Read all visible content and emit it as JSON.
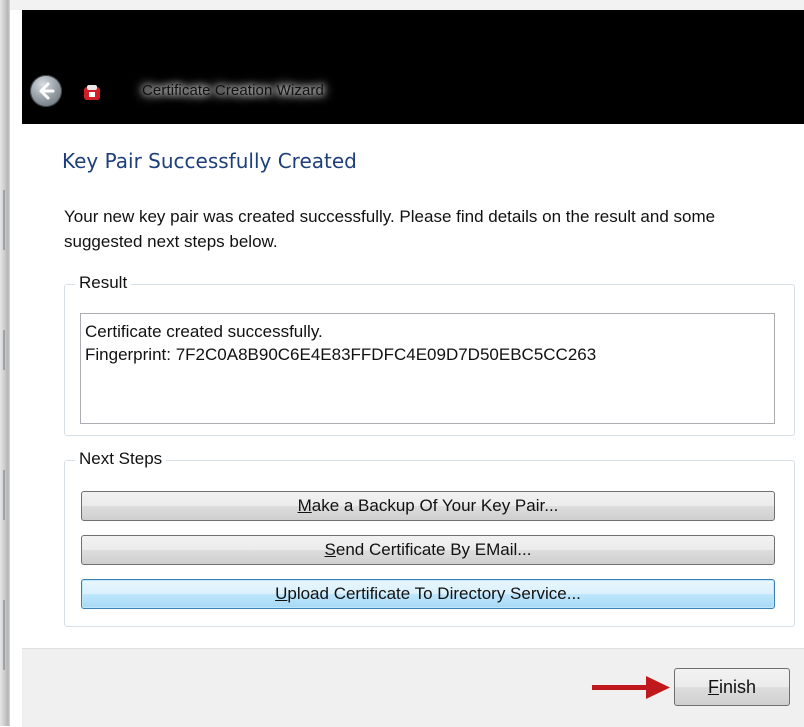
{
  "window": {
    "title": "Certificate Creation Wizard",
    "back_icon": "back-arrow-icon",
    "app_icon": "certificate-app-icon"
  },
  "page": {
    "title": "Key Pair Successfully Created",
    "description": "Your new key pair was created successfully. Please find details on the result and some suggested next steps below."
  },
  "result": {
    "label": "Result",
    "lines": [
      "Certificate created successfully.",
      "Fingerprint: 7F2C0A8B90C6E4E83FFDFC4E09D7D50EBC5CC263"
    ]
  },
  "next_steps": {
    "label": "Next Steps",
    "buttons": [
      {
        "accel": "M",
        "rest": "ake a Backup Of Your Key Pair..."
      },
      {
        "accel": "S",
        "rest": "end Certificate By EMail..."
      },
      {
        "accel": "U",
        "rest": "pload Certificate To Directory Service..."
      }
    ]
  },
  "footer": {
    "finish": {
      "accel": "F",
      "rest": "inish"
    },
    "annotation_icon": "red-arrow-icon"
  },
  "colors": {
    "titlebar": "#000000",
    "page_title": "#1e3f7a",
    "annotation_arrow": "#c0191d",
    "focused_button": "#bee6fd"
  }
}
